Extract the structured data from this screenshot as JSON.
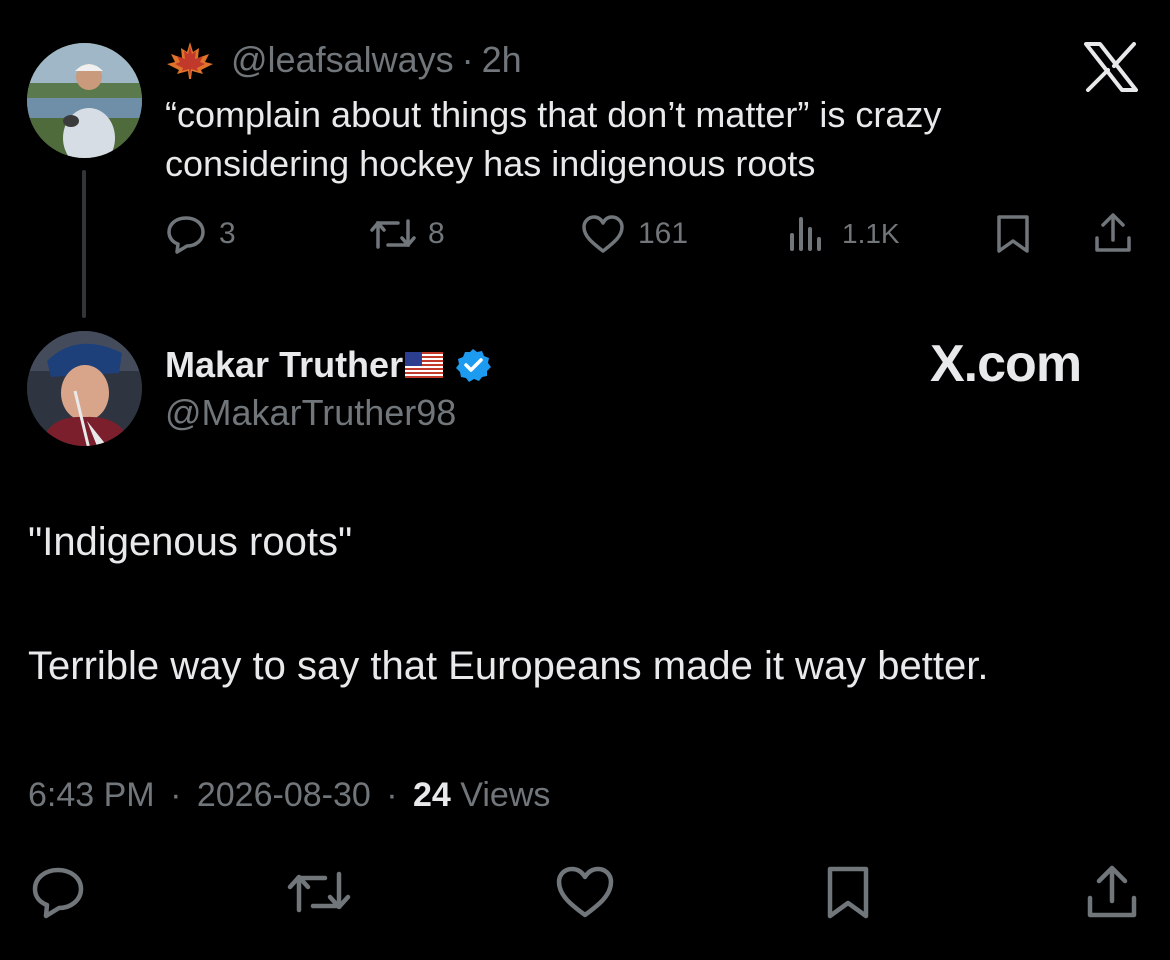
{
  "parent_tweet": {
    "handle": "@leafsalways",
    "separator": "·",
    "time": "2h",
    "text": "“complain about things that don’t matter” is crazy considering hockey has indigenous roots",
    "replies": "3",
    "reposts": "8",
    "likes": "161",
    "views": "1.1K",
    "flair_icon": "maple-leaf-icon"
  },
  "reply_tweet": {
    "display_name": "Makar Truther",
    "flag_emoji": "🇺🇸",
    "handle": "@MakarTruther98",
    "text_line_1": "\"Indigenous roots\"",
    "text_line_2": "Terrible way to say that Europeans made it way better.",
    "time": "6:43 PM",
    "date": "2026-08-30",
    "views_count": "24",
    "views_label": "Views",
    "separator": "·"
  },
  "branding": {
    "watermark": "X.com"
  },
  "colors": {
    "background": "#000000",
    "text": "#e7e9ea",
    "muted": "#71767b",
    "verified": "#1d9bf0",
    "maple": "#e0732a"
  }
}
